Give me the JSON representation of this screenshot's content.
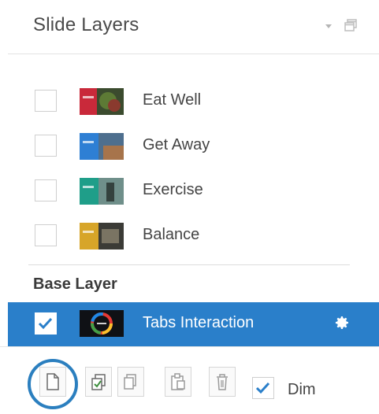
{
  "panel": {
    "title": "Slide Layers",
    "accent_color": "#2a7fca"
  },
  "layers": [
    {
      "label": "Eat Well",
      "checked": false,
      "thumb_color": "#c9293a"
    },
    {
      "label": "Get  Away",
      "checked": false,
      "thumb_color": "#2e7fd4"
    },
    {
      "label": "Exercise",
      "checked": false,
      "thumb_color": "#1f9e89"
    },
    {
      "label": "Balance",
      "checked": false,
      "thumb_color": "#d7a529"
    }
  ],
  "base": {
    "section_title": "Base Layer",
    "label": "Tabs Interaction",
    "checked": true
  },
  "toolbar": {
    "dim_label": "Dim",
    "dim_checked": true,
    "icons": [
      "new-layer-icon",
      "duplicate-layer-icon",
      "copy-icon",
      "paste-icon",
      "delete-icon"
    ]
  }
}
